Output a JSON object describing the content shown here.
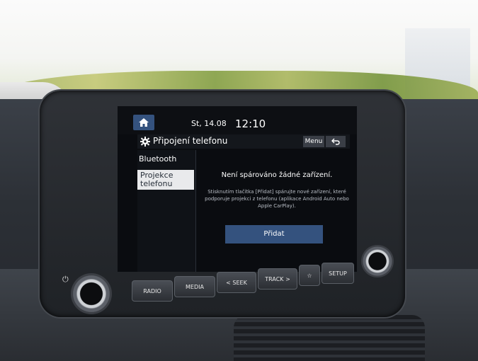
{
  "screen": {
    "date": "St, 14.08",
    "time": "12:10",
    "title": "Připojení telefonu",
    "menu_label": "Menu",
    "sidebar": {
      "items": [
        {
          "label": "Bluetooth"
        },
        {
          "label": "Projekce telefonu",
          "selected": true
        }
      ]
    },
    "message_title": "Není spárováno žádné zařízení.",
    "message_body": "Stisknutím tlačítka [Přidat] spárujte nové zařízení, které podporuje projekci z telefonu (aplikace Android Auto nebo Apple CarPlay).",
    "add_label": "Přidat"
  },
  "physical_buttons": {
    "radio": "RADIO",
    "media": "MEDIA",
    "seek": "< SEEK",
    "track": "TRACK >",
    "favorite": "☆",
    "setup": "SETUP"
  },
  "icons": {
    "home": "home-icon",
    "gear": "gear-icon",
    "back": "back-arrow-icon",
    "power": "power-icon"
  },
  "colors": {
    "accent": "#34527e",
    "selected_bg": "#e9eaec"
  }
}
